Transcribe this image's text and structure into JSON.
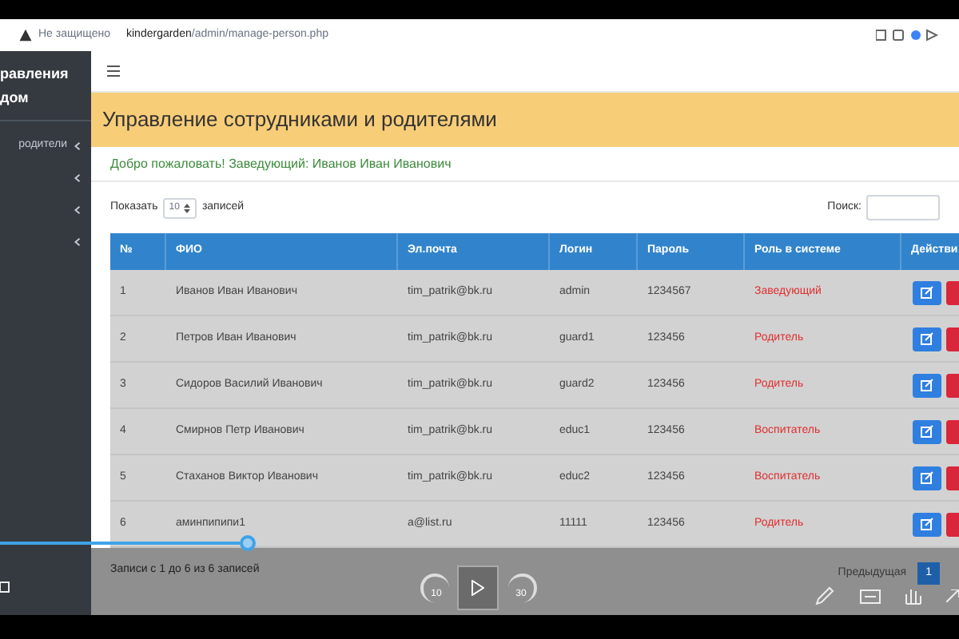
{
  "browser": {
    "security": "Не защищено",
    "url_host": "kindergarden",
    "url_path": "/admin/manage-person.php"
  },
  "sidebar": {
    "brand": [
      "равления",
      "дом"
    ],
    "items": [
      {
        "label": "родители",
        "expanded": false
      },
      {
        "expanded": false
      },
      {
        "expanded": false
      },
      {
        "expanded": false
      }
    ]
  },
  "page": {
    "title": "Управление сотрудниками и родителями",
    "welcome": "Добро пожаловать! Заведующий: Иванов Иван Иванович"
  },
  "table_controls": {
    "show_label": "Показать",
    "page_size": "10",
    "entries_label": "записей",
    "search_label": "Поиск:"
  },
  "table": {
    "columns": [
      "№",
      "ФИО",
      "Эл.почта",
      "Логин",
      "Пароль",
      "Роль в системе",
      "Действи"
    ],
    "rows": [
      [
        "1",
        "Иванов Иван Иванович",
        "tim_patrik@bk.ru",
        "admin",
        "1234567",
        "Заведующий"
      ],
      [
        "2",
        "Петров Иван Иванович",
        "tim_patrik@bk.ru",
        "guard1",
        "123456",
        "Родитель"
      ],
      [
        "3",
        "Сидоров Василий Иванович",
        "tim_patrik@bk.ru",
        "guard2",
        "123456",
        "Родитель"
      ],
      [
        "4",
        "Смирнов Петр Иванович",
        "tim_patrik@bk.ru",
        "educ1",
        "123456",
        "Воспитатель"
      ],
      [
        "5",
        "Стаханов Виктор Иванович",
        "tim_patrik@bk.ru",
        "educ2",
        "123456",
        "Воспитатель"
      ],
      [
        "6",
        "аминпипипи1",
        "a@list.ru",
        "11111",
        "123456",
        "Родитель"
      ]
    ]
  },
  "table_footer": {
    "info": "Записи с 1 до 6 из 6 записей",
    "pagination": [
      {
        "label": "Предыдущая",
        "selected": false
      },
      {
        "label": "1",
        "selected": true
      }
    ]
  },
  "video_player": {
    "progress": {
      "level": 0.25
    },
    "rewind_label": "10",
    "forward_label": "30"
  }
}
